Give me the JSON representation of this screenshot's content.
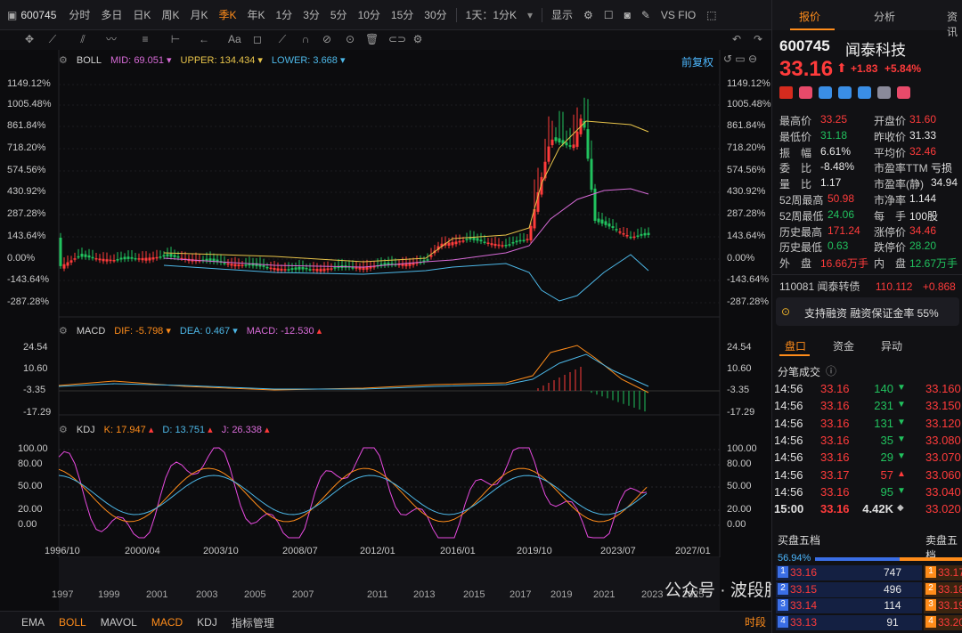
{
  "toolbar": {
    "symbol": "600745",
    "timeframes": [
      "分时",
      "多日",
      "日K",
      "周K",
      "月K",
      "季K",
      "年K",
      "1分",
      "3分",
      "5分",
      "10分",
      "15分",
      "30分"
    ],
    "active_timeframe": "季K",
    "multi": "1天：1分K",
    "display": "显示",
    "vs": "VS FIO"
  },
  "boll": {
    "name": "BOLL",
    "mid_label": "MID:",
    "mid": "69.051",
    "upper_label": "UPPER:",
    "upper": "134.434",
    "lower_label": "LOWER:",
    "lower": "3.668",
    "adjust": "前复权",
    "yticks": [
      "1149.12%",
      "1005.48%",
      "861.84%",
      "718.20%",
      "574.56%",
      "430.92%",
      "287.28%",
      "143.64%",
      "0.00%",
      "-143.64%",
      "-287.28%"
    ],
    "yticks_right": [
      "1149.12%",
      "1005.48%",
      "861.84%",
      "718.20%",
      "574.56%",
      "430.92%",
      "287.28%",
      "143.64%",
      "0.00%",
      "-143.64%",
      "-287.28%"
    ]
  },
  "macd": {
    "name": "MACD",
    "dif_label": "DIF:",
    "dif": "-5.798",
    "dea_label": "DEA:",
    "dea": "0.467",
    "macd_label": "MACD:",
    "macd": "-12.530",
    "yticks": [
      "24.54",
      "10.60",
      "-3.35",
      "-17.29"
    ]
  },
  "kdj": {
    "name": "KDJ",
    "k_label": "K:",
    "k": "17.947",
    "d_label": "D:",
    "d": "13.751",
    "j_label": "J:",
    "j": "26.338",
    "yticks": [
      "100.00",
      "80.00",
      "50.00",
      "20.00",
      "0.00"
    ]
  },
  "xaxis": {
    "dates": [
      "1996/10",
      "2000/04",
      "2003/10",
      "2008/07",
      "2012/01",
      "2016/01",
      "2019/10",
      "2023/07",
      "2027/01"
    ],
    "years": [
      "1997",
      "1999",
      "2001",
      "2003",
      "2005",
      "2007",
      "2011",
      "2013",
      "2015",
      "2017",
      "2019",
      "2021",
      "2023",
      "2025"
    ]
  },
  "bottom_tabs": [
    "EMA",
    "BOLL",
    "MAVOL",
    "MACD",
    "KDJ",
    "指标管理"
  ],
  "bottom_active": [
    "BOLL",
    "MACD"
  ],
  "bottom_right": "时段",
  "watermark": "公众号 · 波段肺鱼",
  "right": {
    "tabs": [
      "报价",
      "分析",
      "资讯"
    ],
    "code": "600745",
    "name": "闻泰科技",
    "price": "33.16",
    "change": "+1.83",
    "change_pct": "+5.84%",
    "quotes": [
      [
        "最高价",
        "33.25",
        "red",
        "开盘价",
        "31.60",
        "red"
      ],
      [
        "最低价",
        "31.18",
        "green",
        "昨收价",
        "31.33",
        "white"
      ],
      [
        "振　幅",
        "6.61%",
        "white",
        "平均价",
        "32.46",
        "red"
      ],
      [
        "委　比",
        "-8.48%",
        "white",
        "市盈率TTM",
        "亏损",
        "white"
      ],
      [
        "量　比",
        "1.17",
        "white",
        "市盈率(静)",
        "34.94",
        "white"
      ],
      [
        "52周最高",
        "50.98",
        "red",
        "市净率",
        "1.144",
        "white"
      ],
      [
        "52周最低",
        "24.06",
        "green",
        "每　手",
        "100股",
        "white"
      ],
      [
        "历史最高",
        "171.24",
        "red",
        "涨停价",
        "34.46",
        "red"
      ],
      [
        "历史最低",
        "0.63",
        "green",
        "跌停价",
        "28.20",
        "green"
      ],
      [
        "外　盘",
        "16.66万手",
        "red",
        "内　盘",
        "12.67万手",
        "green"
      ]
    ],
    "bond_code": "110081",
    "bond_name": "闻泰转债",
    "bond_price": "110.112",
    "bond_change": "+0.868",
    "margin_text": "支持融资 融资保证金率 55%",
    "subtabs": [
      "盘口",
      "资金",
      "异动"
    ],
    "ticks_title": "分笔成交",
    "ticks": [
      [
        "14:56",
        "33.16",
        "140",
        "down"
      ],
      [
        "14:56",
        "33.16",
        "231",
        "down"
      ],
      [
        "14:56",
        "33.16",
        "131",
        "down"
      ],
      [
        "14:56",
        "33.16",
        "35",
        "down"
      ],
      [
        "14:56",
        "33.16",
        "29",
        "down"
      ],
      [
        "14:56",
        "33.17",
        "57",
        "up"
      ],
      [
        "14:56",
        "33.16",
        "95",
        "down"
      ],
      [
        "15:00",
        "33.16",
        "4.42K",
        "flat"
      ]
    ],
    "right_prices": [
      "33.160",
      "33.150",
      "33.120",
      "33.080",
      "33.070",
      "33.060",
      "33.040",
      "33.020"
    ],
    "buy_title": "买盘五档",
    "sell_title": "卖盘五档",
    "ratio": "56.94%",
    "buy": [
      [
        "1",
        "33.16",
        "747"
      ],
      [
        "2",
        "33.15",
        "496"
      ],
      [
        "3",
        "33.14",
        "114"
      ],
      [
        "4",
        "33.13",
        "91"
      ]
    ],
    "sell": [
      [
        "1",
        "33.17"
      ],
      [
        "2",
        "33.18"
      ],
      [
        "3",
        "33.19"
      ],
      [
        "4",
        "33.20"
      ]
    ]
  }
}
